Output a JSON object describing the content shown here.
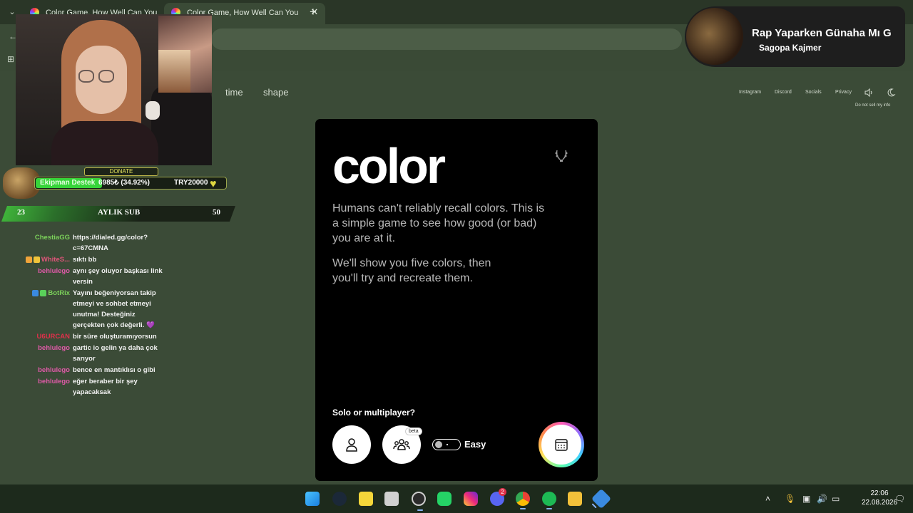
{
  "browser": {
    "tabs": [
      {
        "label": "Color Game, How Well Can You"
      },
      {
        "label": "Color Game, How Well Can You"
      }
    ],
    "new_tab_icon": "plus-icon"
  },
  "site": {
    "nav": {
      "time": "time",
      "shape": "shape"
    },
    "top_links": {
      "instagram": "Instagram",
      "discord": "Discord",
      "socials": "Socials",
      "privacy": "Privacy",
      "do_not_sell": "Do not sell my info"
    }
  },
  "game": {
    "title": "color",
    "intro": "Humans can't reliably recall colors. This is a simple game to see how good (or bad) you are at it.",
    "intro2": "We'll show you five colors, then you'll try and recreate them.",
    "mode_question": "Solo or multiplayer?",
    "beta_badge": "beta",
    "difficulty": "Easy"
  },
  "overlay": {
    "donate": {
      "header": "DONATE",
      "name": "Ekipman Destek",
      "amount": "6985₺ (34.92%)",
      "goal": "TRY20000",
      "progress": 0.3492
    },
    "subs": {
      "current": "23",
      "label": "AYLIK SUB",
      "target": "50"
    },
    "chat": [
      {
        "user": "ChestiaGG",
        "color": "#7bd15a",
        "msg": "https://dialed.gg/color?c=67CMNA",
        "badges": []
      },
      {
        "user": "WhiteS...",
        "color": "#e0557a",
        "msg": "sıktı bb",
        "badges": [
          "#f0a43a",
          "#f0c43a"
        ]
      },
      {
        "user": "behlulego",
        "color": "#e05aa8",
        "msg": "aynı şey oluyor başkası link versin",
        "badges": []
      },
      {
        "user": "BotRix",
        "color": "#7bd15a",
        "msg": "Yayını beğeniyorsan takip etmeyi ve sohbet etmeyi unutma! Desteğiniz gerçekten çok değerli. 💜",
        "badges": [
          "#3a8ae0",
          "#5ad15a"
        ]
      },
      {
        "user": "U6URCAN",
        "color": "#e0304a",
        "msg": "bir süre oluşturamıyorsun",
        "badges": []
      },
      {
        "user": "behlulego",
        "color": "#e05aa8",
        "msg": "gartic io gelin ya daha çok sarıyor",
        "badges": []
      },
      {
        "user": "behlulego",
        "color": "#e05aa8",
        "msg": "bence en mantıklısı o gibi",
        "badges": []
      },
      {
        "user": "behlulego",
        "color": "#e05aa8",
        "msg": "eğer beraber bir şey yapacaksak",
        "badges": []
      }
    ],
    "now_playing": {
      "title": "Rap Yaparken Günaha Mı G",
      "artist": "Sagopa Kajmer"
    }
  },
  "taskbar": {
    "time": "22:06",
    "date": "22.08.2026",
    "apps": [
      "windows-start-icon",
      "steam-icon",
      "sticky-notes-icon",
      "snipping-tool-icon",
      "obs-icon",
      "whatsapp-icon",
      "instagram-icon",
      "discord-icon",
      "chrome-icon",
      "spotify-icon",
      "file-explorer-icon",
      "settings-icon"
    ],
    "discord_badge": "2"
  },
  "colors": {
    "card_bg": "#000000",
    "page_bg": "#3b4b37",
    "accent_green": "#37d43a"
  }
}
